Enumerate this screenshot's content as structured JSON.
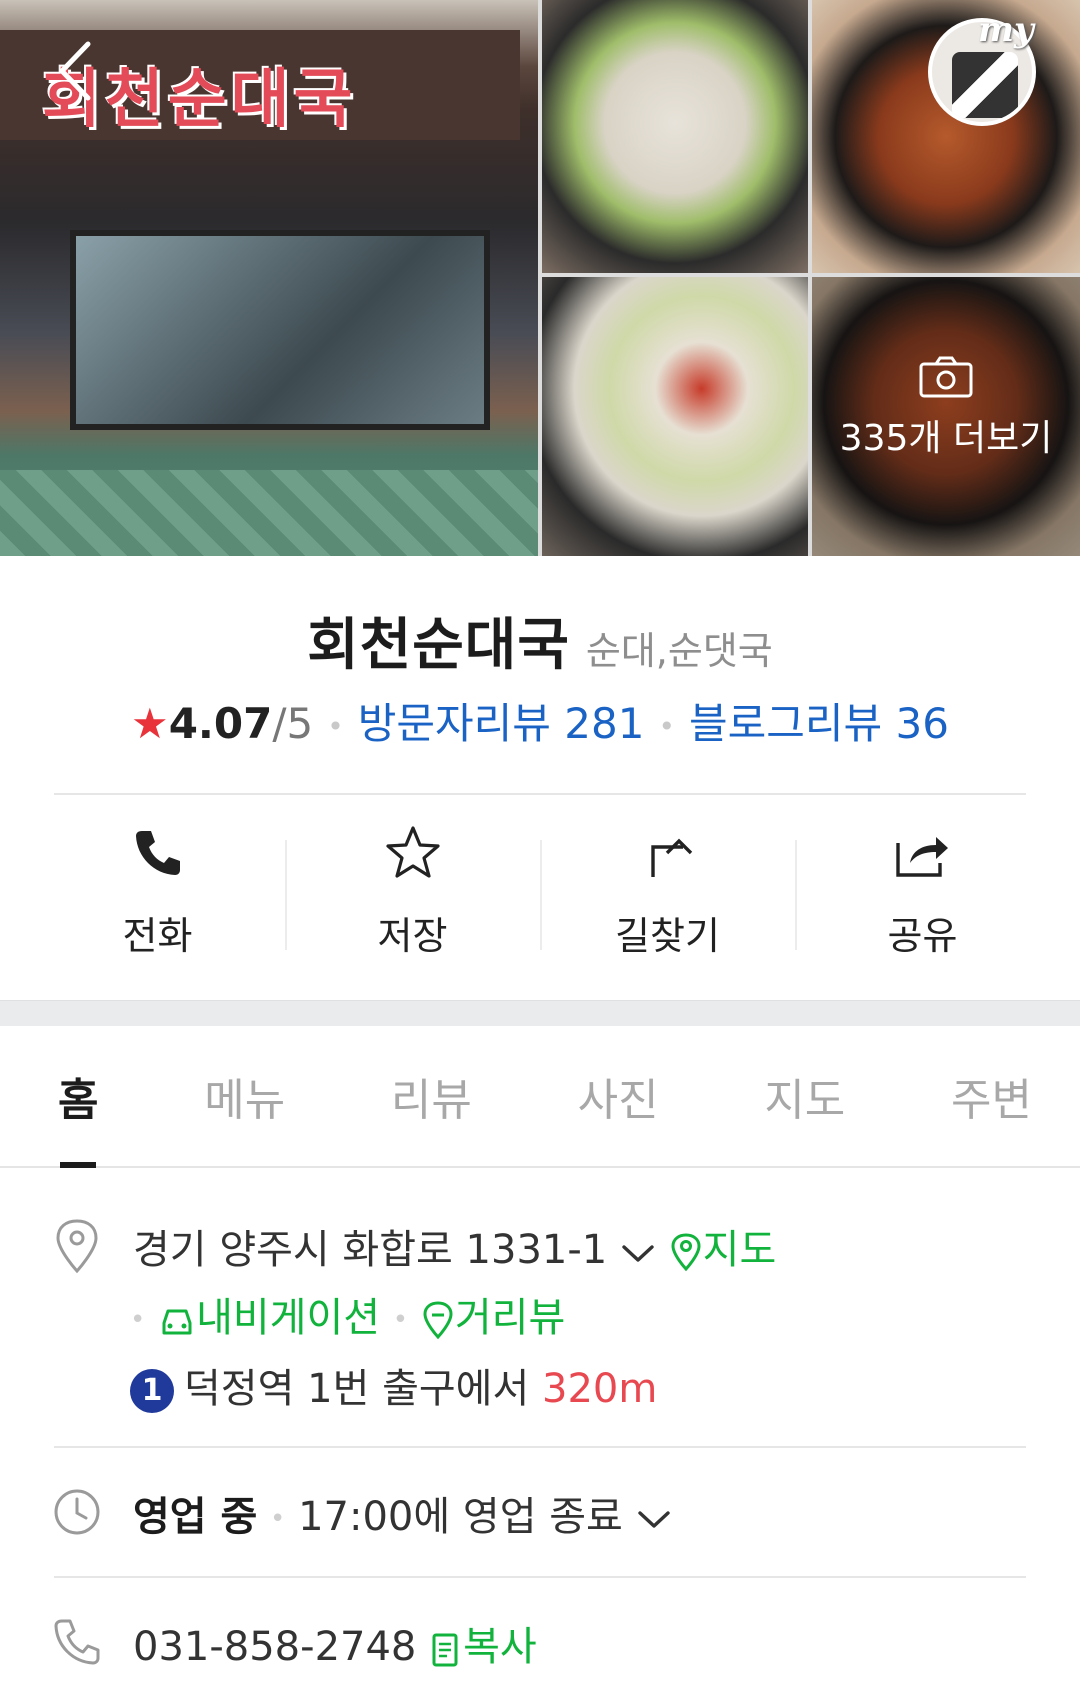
{
  "gallery": {
    "storefront_sign": "회천순대국",
    "my_badge": "my",
    "more_photos_label": "335개 더보기"
  },
  "place": {
    "name": "회천순대국",
    "category": "순대,순댓국",
    "rating": "4.07",
    "rating_max": "/5",
    "visitor_reviews": "방문자리뷰 281",
    "blog_reviews": "블로그리뷰 36"
  },
  "actions": [
    {
      "label": "전화",
      "icon": "phone-icon"
    },
    {
      "label": "저장",
      "icon": "star-outline-icon"
    },
    {
      "label": "길찾기",
      "icon": "directions-icon"
    },
    {
      "label": "공유",
      "icon": "share-icon"
    }
  ],
  "tabs": [
    {
      "label": "홈",
      "active": true
    },
    {
      "label": "메뉴"
    },
    {
      "label": "리뷰"
    },
    {
      "label": "사진"
    },
    {
      "label": "지도"
    },
    {
      "label": "주변"
    }
  ],
  "info": {
    "address": "경기 양주시 화합로 1331-1",
    "map_link": "지도",
    "navigation_link": "내비게이션",
    "streetview_link": "거리뷰",
    "subway_line": "1",
    "station_text": "덕정역 1번 출구에서",
    "station_distance": "320m",
    "hours_status": "영업 중",
    "hours_detail": "17:00에 영업 종료",
    "phone": "031-858-2748",
    "copy_label": "복사"
  },
  "colors": {
    "accent_green": "#12b33c",
    "link_blue": "#1a63c5",
    "star_red": "#e8333b",
    "distance_red": "#e8484f",
    "subway_line1": "#203a9c"
  }
}
